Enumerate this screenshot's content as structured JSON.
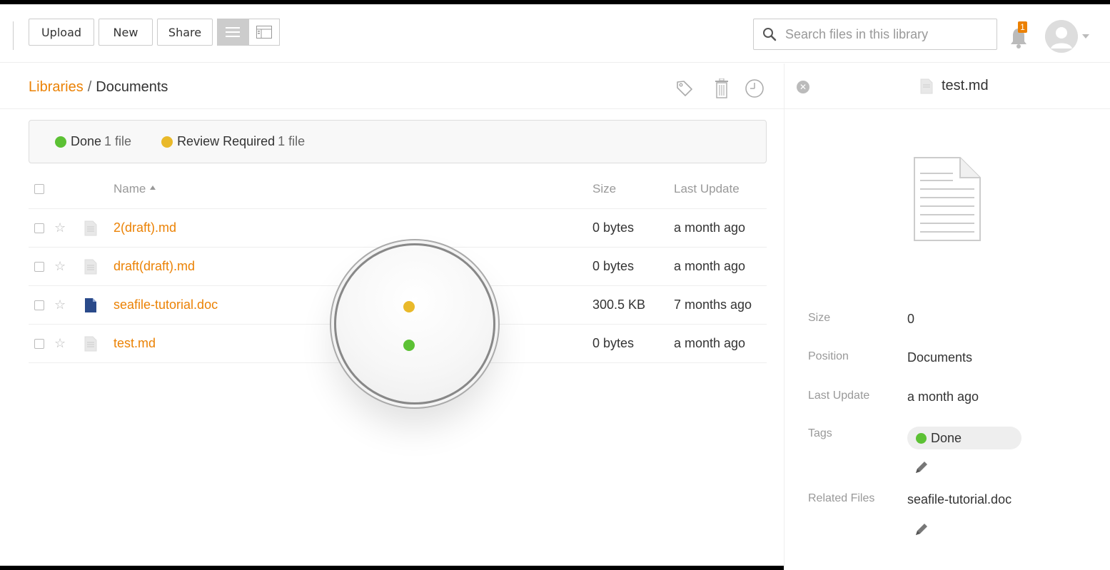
{
  "toolbar": {
    "upload_label": "Upload",
    "new_label": "New",
    "share_label": "Share",
    "list_view_icon": "list-view-icon",
    "grid_view_icon": "column-view-icon"
  },
  "search": {
    "placeholder": "Search files in this library"
  },
  "notifications": {
    "count": "1"
  },
  "breadcrumb": {
    "root": "Libraries",
    "separator": "/",
    "current": "Documents"
  },
  "tag_summary": [
    {
      "name": "Done",
      "count": "1 file",
      "color": "#5cc134"
    },
    {
      "name": "Review Required",
      "count": "1 file",
      "color": "#e9b92a"
    }
  ],
  "table": {
    "headers": {
      "name": "Name",
      "size": "Size",
      "updated": "Last Update"
    },
    "rows": [
      {
        "name": "2(draft).md",
        "size": "0 bytes",
        "updated": "a month ago",
        "icon": "text-file-icon"
      },
      {
        "name": "draft(draft).md",
        "size": "0 bytes",
        "updated": "a month ago",
        "icon": "text-file-icon"
      },
      {
        "name": "seafile-tutorial.doc",
        "size": "300.5 KB",
        "updated": "7 months ago",
        "icon": "word-file-icon"
      },
      {
        "name": "test.md",
        "size": "0 bytes",
        "updated": "a month ago",
        "icon": "text-file-icon"
      }
    ]
  },
  "magnifier": {
    "tag_colors": [
      "#e9b92a",
      "#5cc134"
    ]
  },
  "detail": {
    "title": "test.md",
    "labels": {
      "size": "Size",
      "position": "Position",
      "updated": "Last Update",
      "tags": "Tags",
      "related": "Related Files"
    },
    "values": {
      "size": "0",
      "position": "Documents",
      "updated": "a month ago",
      "tag": "Done",
      "related": "seafile-tutorial.doc"
    },
    "tag_color": "#5cc134"
  },
  "colors": {
    "accent": "#eb8205",
    "done": "#5cc134",
    "review": "#e9b92a"
  }
}
